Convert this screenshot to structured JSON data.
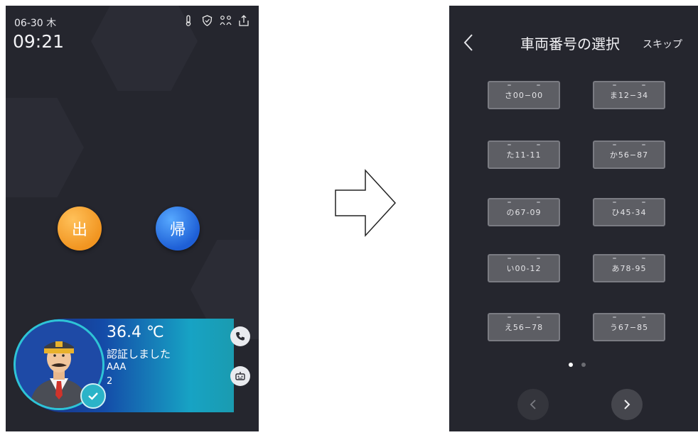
{
  "left_screen": {
    "date": "06-30 木",
    "time": "09:21",
    "status_icons": [
      "thermometer-icon",
      "shield-icon",
      "network-icon",
      "usb-icon"
    ],
    "button_out_label": "出",
    "button_back_label": "帰",
    "auth": {
      "temperature": "36.4 ℃",
      "message": "認証しました",
      "name": "AAA",
      "number": "2"
    }
  },
  "right_screen": {
    "title": "車両番号の選択",
    "skip_label": "スキップ",
    "plates": [
      "さ00−00",
      "ま12−34",
      "た11-11",
      "か56−87",
      "の67-09",
      "ひ45-34",
      "い00-12",
      "あ78-95",
      "え56−78",
      "う67−85"
    ],
    "current_page": 1,
    "total_pages": 2
  },
  "colors": {
    "screen_bg": "#25262e",
    "out_button": "#f19521",
    "back_button": "#1e5fd6",
    "accent_teal": "#2bb3c8"
  }
}
